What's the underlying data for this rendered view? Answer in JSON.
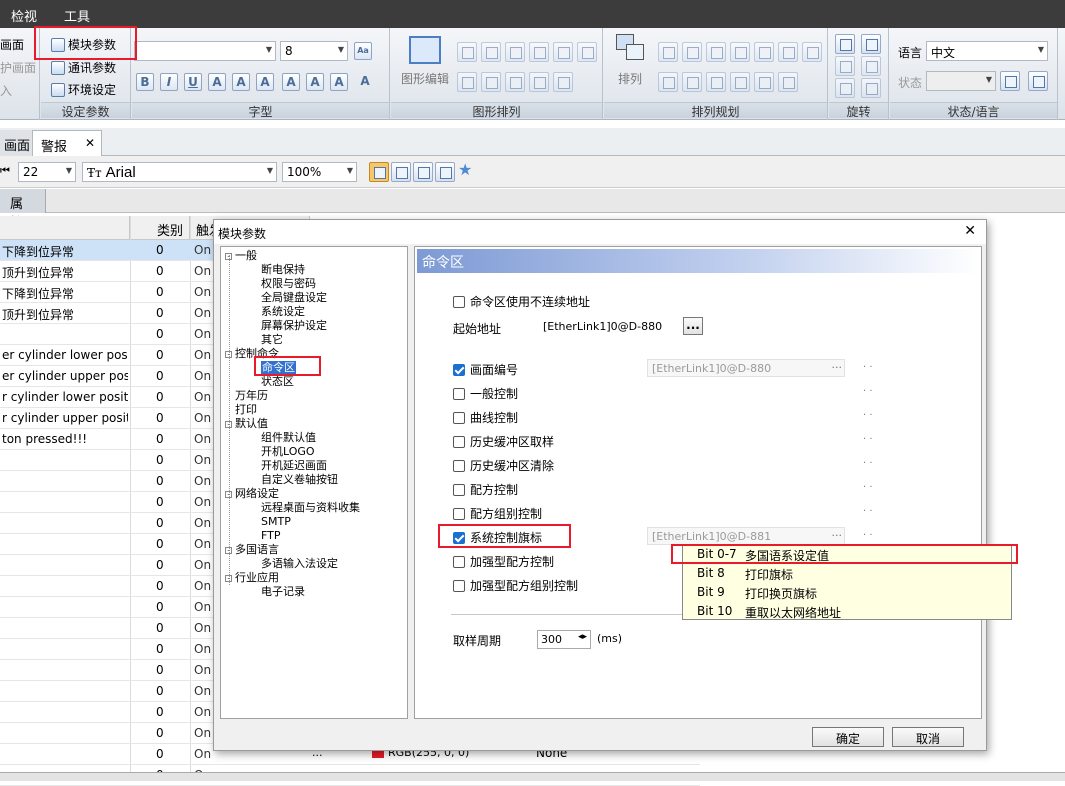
{
  "menu": {
    "items": [
      "检视",
      "工具"
    ]
  },
  "ribbon": {
    "left_items": [
      "画面",
      "护画面",
      "入"
    ],
    "settings": {
      "items": [
        "模块参数",
        "通讯参数",
        "环境设定"
      ],
      "label": "设定参数"
    },
    "font": {
      "label": "字型",
      "size": "8"
    },
    "graphic": {
      "edit": "图形编辑",
      "label": "图形排列"
    },
    "arrange": {
      "sort": "排列",
      "label": "排列规划"
    },
    "rotate": {
      "label": "旋转"
    },
    "state": {
      "lang_label": "语言",
      "lang_value": "中文",
      "state_label": "状态",
      "label": "状态/语言"
    }
  },
  "tabs": {
    "left": "画面",
    "active": "警报"
  },
  "toolbar2": {
    "number": "22",
    "font": "Arial",
    "zoom": "100%"
  },
  "props_tab": "属性",
  "grid": {
    "headers": [
      "",
      "类别",
      "触发"
    ],
    "rows": [
      [
        "下降到位异常",
        "0",
        "On"
      ],
      [
        "顶升到位异常",
        "0",
        "On"
      ],
      [
        "下降到位异常",
        "0",
        "On"
      ],
      [
        "顶升到位异常",
        "0",
        "On"
      ],
      [
        "",
        "0",
        "On"
      ],
      [
        "er cylinder lower position",
        "0",
        "On"
      ],
      [
        "er cylinder upper position",
        "0",
        "On"
      ],
      [
        "r cylinder lower position",
        "0",
        "On"
      ],
      [
        "r cylinder upper position",
        "0",
        "On"
      ],
      [
        "ton pressed!!!",
        "0",
        "On"
      ],
      [
        "",
        "0",
        "On"
      ],
      [
        "",
        "0",
        "On"
      ],
      [
        "",
        "0",
        "On"
      ],
      [
        "",
        "0",
        "On"
      ],
      [
        "",
        "0",
        "On"
      ],
      [
        "",
        "0",
        "On"
      ],
      [
        "",
        "0",
        "On"
      ],
      [
        "",
        "0",
        "On"
      ],
      [
        "",
        "0",
        "On"
      ],
      [
        "",
        "0",
        "On"
      ],
      [
        "",
        "0",
        "On"
      ],
      [
        "",
        "0",
        "On"
      ],
      [
        "",
        "0",
        "On"
      ],
      [
        "",
        "0",
        "On"
      ],
      [
        "",
        "0",
        "On"
      ],
      [
        "",
        "0",
        "On"
      ]
    ],
    "bottom": {
      "dots": "...",
      "color": "RGB(255, 0, 0)",
      "none": "None"
    }
  },
  "dialog": {
    "title": "模块参数",
    "close": "✕",
    "tree": [
      {
        "label": "一般",
        "level": 0,
        "box": "-"
      },
      {
        "label": "断电保持",
        "level": 1
      },
      {
        "label": "权限与密码",
        "level": 1
      },
      {
        "label": "全局键盘设定",
        "level": 1
      },
      {
        "label": "系统设定",
        "level": 1
      },
      {
        "label": "屏幕保护设定",
        "level": 1
      },
      {
        "label": "其它",
        "level": 1
      },
      {
        "label": "控制命令",
        "level": 0,
        "box": "-"
      },
      {
        "label": "命令区",
        "level": 1,
        "selected": true
      },
      {
        "label": "状态区",
        "level": 1
      },
      {
        "label": "万年历",
        "level": 0
      },
      {
        "label": "打印",
        "level": 0
      },
      {
        "label": "默认值",
        "level": 0,
        "box": "-"
      },
      {
        "label": "组件默认值",
        "level": 1
      },
      {
        "label": "开机LOGO",
        "level": 1
      },
      {
        "label": "开机延迟画面",
        "level": 1
      },
      {
        "label": "自定义卷轴按钮",
        "level": 1
      },
      {
        "label": "网络设定",
        "level": 0,
        "box": "-"
      },
      {
        "label": "远程桌面与资料收集",
        "level": 1
      },
      {
        "label": "SMTP",
        "level": 1
      },
      {
        "label": "FTP",
        "level": 1
      },
      {
        "label": "多国语言",
        "level": 0,
        "box": "-"
      },
      {
        "label": "多语输入法设定",
        "level": 1
      },
      {
        "label": "行业应用",
        "level": 0,
        "box": "-"
      },
      {
        "label": "电子记录",
        "level": 1
      }
    ],
    "panel": {
      "title": "命令区",
      "noncontig": "命令区使用不连续地址",
      "start_label": "起始地址",
      "start_value": "[EtherLink1]0@D-880",
      "browse": "...",
      "options": [
        {
          "label": "画面编号",
          "checked": true,
          "addr": "[EtherLink1]0@D-880"
        },
        {
          "label": "一般控制",
          "checked": false
        },
        {
          "label": "曲线控制",
          "checked": false
        },
        {
          "label": "历史缓冲区取样",
          "checked": false
        },
        {
          "label": "历史缓冲区清除",
          "checked": false
        },
        {
          "label": "配方控制",
          "checked": false
        },
        {
          "label": "配方组别控制",
          "checked": false
        },
        {
          "label": "系统控制旗标",
          "checked": true,
          "addr": "[EtherLink1]0@D-881"
        },
        {
          "label": "加强型配方控制",
          "checked": false
        },
        {
          "label": "加强型配方组别控制",
          "checked": false
        }
      ],
      "period_label": "取样周期",
      "period_value": "300",
      "period_unit": "(ms)",
      "trail": ". ."
    },
    "ok": "确定",
    "cancel": "取消"
  },
  "popup": [
    {
      "bit": "Bit 0-7",
      "desc": "多国语系设定值"
    },
    {
      "bit": "Bit 8",
      "desc": "打印旗标"
    },
    {
      "bit": "Bit 9",
      "desc": "打印换页旗标"
    },
    {
      "bit": "Bit 10",
      "desc": "重取以太网络地址"
    }
  ]
}
